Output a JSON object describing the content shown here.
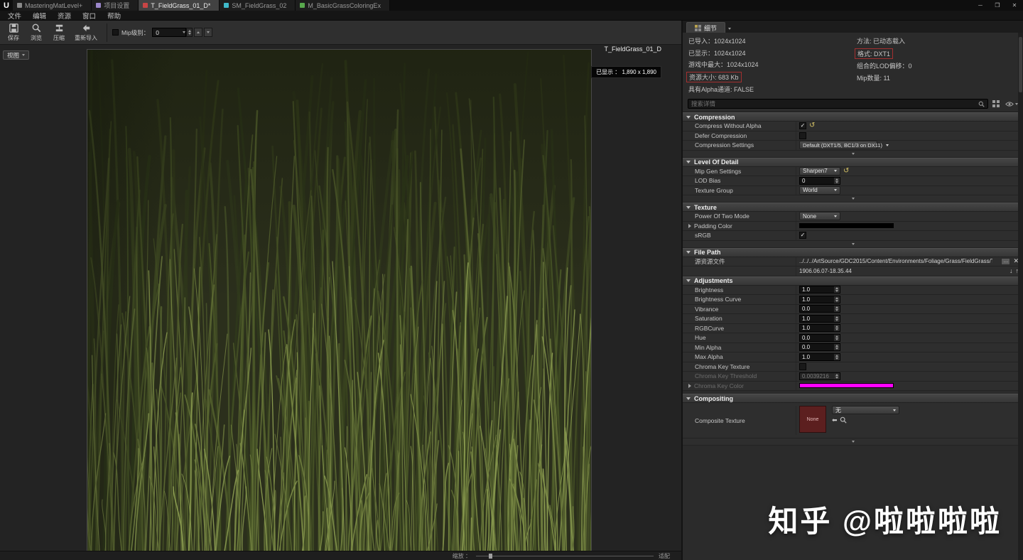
{
  "titlebar": {
    "tabs": [
      {
        "label": "MasteringMatLevel+"
      },
      {
        "label": "项目设置"
      },
      {
        "label": "T_FieldGrass_01_D*"
      },
      {
        "label": "SM_FieldGrass_02"
      },
      {
        "label": "M_BasicGrassColoringEx"
      }
    ]
  },
  "menubar": {
    "items": [
      "文件",
      "编辑",
      "资源",
      "窗口",
      "帮助"
    ]
  },
  "toolbar": {
    "save": "保存",
    "browse": "浏览",
    "compress": "压缩",
    "reimport": "重新导入",
    "mip_label": "Mip级别：",
    "mip_value": "0"
  },
  "viewport": {
    "view_button": "视图",
    "texture_name": "T_FieldGrass_01_D",
    "display_badge": "已显示 ：  1,890 x 1,890",
    "zoom_label": "缩放 ：",
    "fit_label": "适配"
  },
  "details": {
    "tab": "细节",
    "info": {
      "imported": "已导入：1024x1024",
      "displayed": "已显示：1024x1024",
      "max_ingame": "游戏中最大：1024x1024",
      "resource_size": "资源大小: 683 Kb",
      "has_alpha": "具有Alpha通道: FALSE",
      "method": "方法: 已动态载入",
      "format": "格式: DXT1",
      "combined_lod_bias": "组合的LOD偏移：0",
      "mip_count": "Mip数量: 11"
    },
    "search_placeholder": "搜索详情",
    "compression": {
      "title": "Compression",
      "compress_without_alpha": "Compress Without Alpha",
      "compress_without_alpha_checked": true,
      "defer_compression": "Defer Compression",
      "defer_compression_checked": false,
      "compression_settings": "Compression Settings",
      "compression_settings_value": "Default (DXT1/5, BC1/3 on DX11)"
    },
    "lod": {
      "title": "Level Of Detail",
      "mip_gen": "Mip Gen Settings",
      "mip_gen_value": "Sharpen7",
      "lod_bias": "LOD Bias",
      "lod_bias_value": "0",
      "texture_group": "Texture Group",
      "texture_group_value": "World"
    },
    "texture": {
      "title": "Texture",
      "pot_mode": "Power Of Two Mode",
      "pot_mode_value": "None",
      "padding_color": "Padding Color",
      "padding_color_hex": "#000000",
      "srgb": "sRGB",
      "srgb_checked": true
    },
    "file_path": {
      "title": "File Path",
      "source_label": "源资源文件",
      "source_value": "../../../ArtSource/GDC2015/Content/Environments/Foliage/Grass/FieldGrass/Texture/T_Fi",
      "timestamp": "1906.06.07-18.35.44"
    },
    "adjustments": {
      "title": "Adjustments",
      "rows": [
        {
          "label": "Brightness",
          "value": "1.0"
        },
        {
          "label": "Brightness Curve",
          "value": "1.0"
        },
        {
          "label": "Vibrance",
          "value": "0.0"
        },
        {
          "label": "Saturation",
          "value": "1.0"
        },
        {
          "label": "RGBCurve",
          "value": "1.0"
        },
        {
          "label": "Hue",
          "value": "0.0"
        },
        {
          "label": "Min Alpha",
          "value": "0.0"
        },
        {
          "label": "Max Alpha",
          "value": "1.0"
        }
      ],
      "chroma_key_texture": "Chroma Key Texture",
      "chroma_key_texture_checked": false,
      "chroma_key_threshold": "Chroma Key Threshold",
      "chroma_key_threshold_value": "0.0039216",
      "chroma_key_color": "Chroma Key Color",
      "chroma_key_color_hex": "#ff00ff"
    },
    "compositing": {
      "title": "Compositing",
      "composite_texture": "Composite Texture",
      "thumb_label": "None",
      "dropdown_value": "无"
    }
  },
  "watermark": "知乎 @啦啦啦啦"
}
